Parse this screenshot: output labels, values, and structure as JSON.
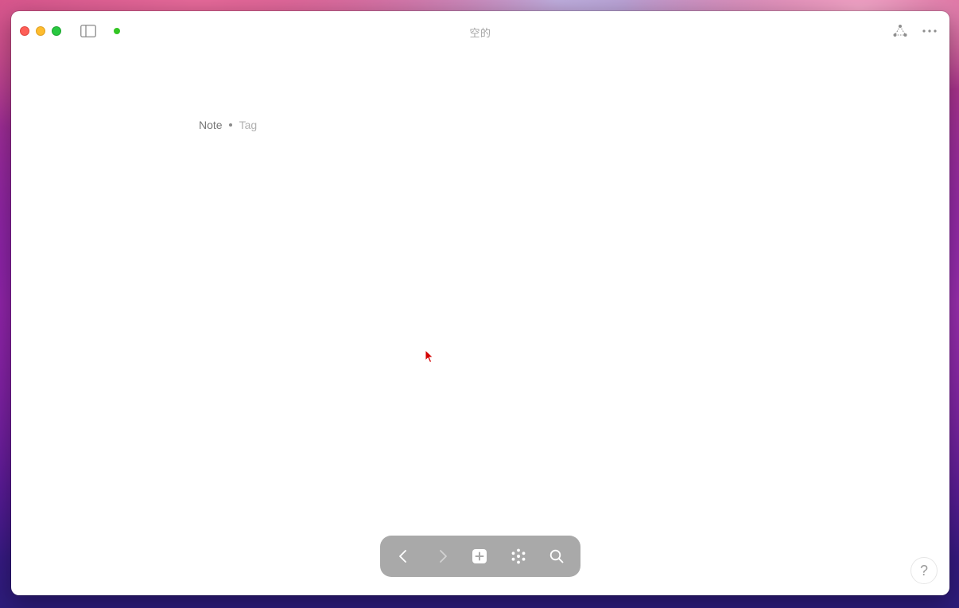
{
  "window": {
    "title": "空的"
  },
  "titlebar": {
    "traffic_lights": [
      "close",
      "minimize",
      "maximize"
    ],
    "left_icons": [
      "sidebar-toggle-icon",
      "sync-status-dot"
    ],
    "right_icons": [
      "graph-icon",
      "more-icon"
    ]
  },
  "note_header": {
    "note_label": "Note",
    "tag_placeholder": "Tag"
  },
  "bottom_toolbar": {
    "buttons": [
      "back-icon",
      "forward-icon",
      "new-note-icon",
      "overview-icon",
      "search-icon"
    ]
  },
  "help": {
    "label": "?"
  },
  "colors": {
    "sync_dot": "#33c524",
    "toolbar_bg": "#a9a9a9",
    "cursor": "#d40000"
  }
}
